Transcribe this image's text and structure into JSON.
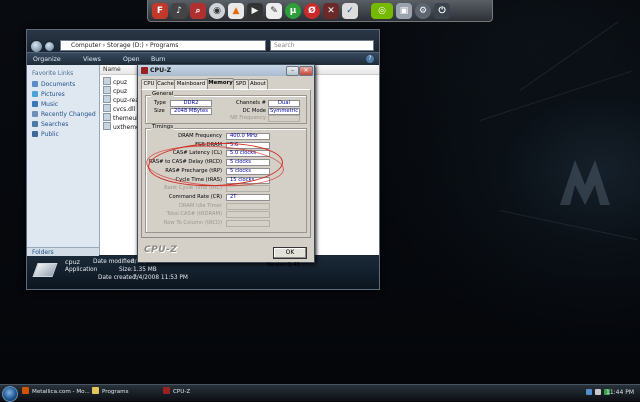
{
  "dock": {
    "icons": [
      "firefox-icon",
      "media-icon",
      "search-icon",
      "disc-icon",
      "vlc-icon",
      "nero-icon",
      "utorrent-icon",
      "winamp-icon",
      "opera-icon",
      "tools-icon",
      "nvidia-icon",
      "display-icon",
      "settings-icon",
      "power-icon"
    ]
  },
  "explorer": {
    "address": "Computer › Storage (D:) › Programs",
    "search_placeholder": "Search",
    "toolbar": {
      "organize": "Organize",
      "views": "Views",
      "open": "Open",
      "burn": "Burn"
    },
    "nav_header": "Favorite Links",
    "nav_items": [
      "Documents",
      "Pictures",
      "Music",
      "Recently Changed",
      "Searches",
      "Public"
    ],
    "folders_label": "Folders",
    "column_name": "Name",
    "files": [
      "cpuz",
      "cpuz",
      "cpuz-readme",
      "cvcs.dll",
      "themeui.dll",
      "uxtheme.dll"
    ],
    "details": {
      "name": "cpuz",
      "type": "Application",
      "modified_label": "Date modified:",
      "modified_value": "8/31/2008 10:52 AM",
      "size_label": "Size:",
      "size_value": "1.35 MB",
      "created_label": "Date created:",
      "created_value": "7/4/2008 11:53 PM"
    }
  },
  "cpuz": {
    "title": "CPU-Z",
    "tabs": [
      "CPU",
      "Cache",
      "Mainboard",
      "Memory",
      "SPD",
      "About"
    ],
    "active_tab": "Memory",
    "general": {
      "title": "General",
      "type_label": "Type",
      "type_value": "DDR2",
      "size_label": "Size",
      "size_value": "2048 MBytes",
      "channels_label": "Channels #",
      "channels_value": "Dual",
      "dc_mode_label": "DC Mode",
      "dc_mode_value": "Symmetric",
      "nb_freq_label": "NB Frequency",
      "nb_freq_value": ""
    },
    "timings": {
      "title": "Timings",
      "rows": [
        {
          "label": "DRAM Frequency",
          "value": "400.0 MHz",
          "disabled": false
        },
        {
          "label": "FSB:DRAM",
          "value": "5:6",
          "disabled": false
        },
        {
          "label": "CAS# Latency (CL)",
          "value": "5.0 clocks",
          "disabled": false
        },
        {
          "label": "RAS# to CAS# Delay (tRCD)",
          "value": "5 clocks",
          "disabled": false
        },
        {
          "label": "RAS# Precharge (tRP)",
          "value": "5 clocks",
          "disabled": false
        },
        {
          "label": "Cycle Time (tRAS)",
          "value": "15 clocks",
          "disabled": false
        },
        {
          "label": "Bank Cycle Time (tRC)",
          "value": "",
          "disabled": true
        },
        {
          "label": "Command Rate (CR)",
          "value": "2T",
          "disabled": false
        },
        {
          "label": "DRAM Idle Timer",
          "value": "",
          "disabled": true
        },
        {
          "label": "Total CAS# (tRDRAM)",
          "value": "",
          "disabled": true
        },
        {
          "label": "Row To Column (tRCD)",
          "value": "",
          "disabled": true
        }
      ]
    },
    "version": "Version 1.46",
    "logo": "CPU-Z",
    "ok_label": "OK"
  },
  "taskbar": {
    "items": [
      "Metallica.com - Mo...",
      "Programs",
      "CPU-Z"
    ],
    "clock": "11:44 PM"
  },
  "colors": {
    "annotation": "#d0281e",
    "value_text": "#0000a0"
  }
}
